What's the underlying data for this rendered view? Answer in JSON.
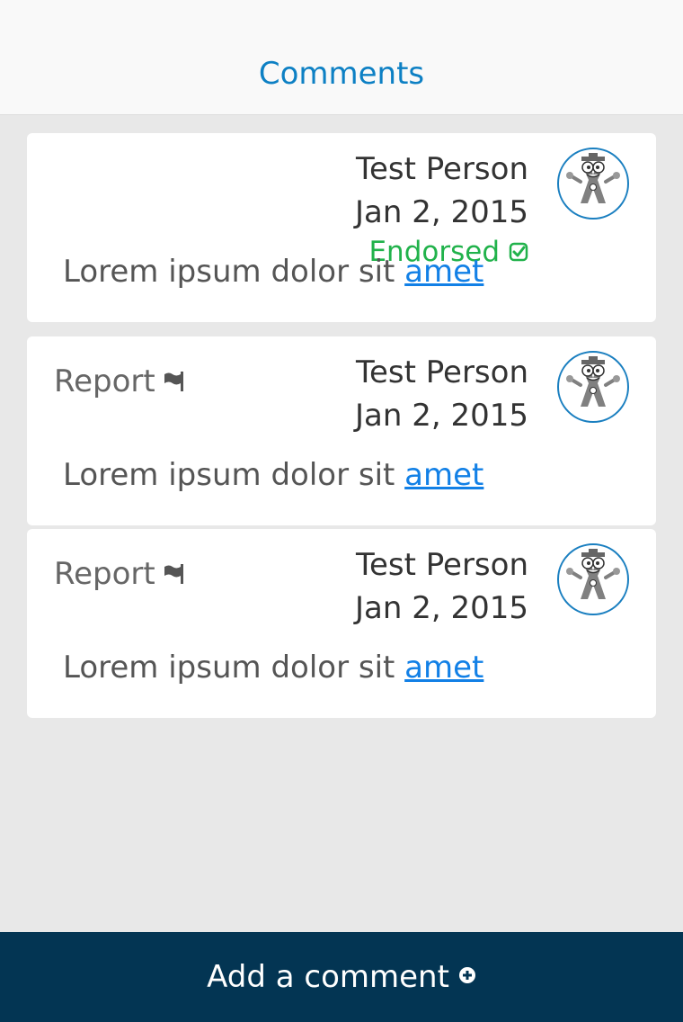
{
  "header": {
    "title": "Comments"
  },
  "comments": [
    {
      "author": "Test Person",
      "date": "Jan 2, 2015",
      "endorsed_label": "Endorsed",
      "body_text": "Lorem ipsum dolor sit ",
      "body_link": "amet",
      "avatar_icon": "student-mascot-avatar",
      "status_icon": "check-square-icon"
    },
    {
      "report_label": "Report",
      "report_icon": "flag-icon",
      "author": "Test Person",
      "date": "Jan 2, 2015",
      "body_text": "Lorem ipsum dolor sit ",
      "body_link": "amet",
      "avatar_icon": "student-mascot-avatar"
    },
    {
      "report_label": "Report",
      "report_icon": "flag-icon",
      "author": "Test Person",
      "date": "Jan 2, 2015",
      "body_text": "Lorem ipsum dolor sit ",
      "body_link": "amet",
      "avatar_icon": "student-mascot-avatar"
    }
  ],
  "footer": {
    "add_comment_label": "Add a comment",
    "add_icon": "plus-circle-icon"
  },
  "colors": {
    "header_title": "#0d80c4",
    "endorsed": "#21b24b",
    "link": "#1280e6",
    "footer_bg": "#033553",
    "page_bg": "#e8e8e8"
  }
}
